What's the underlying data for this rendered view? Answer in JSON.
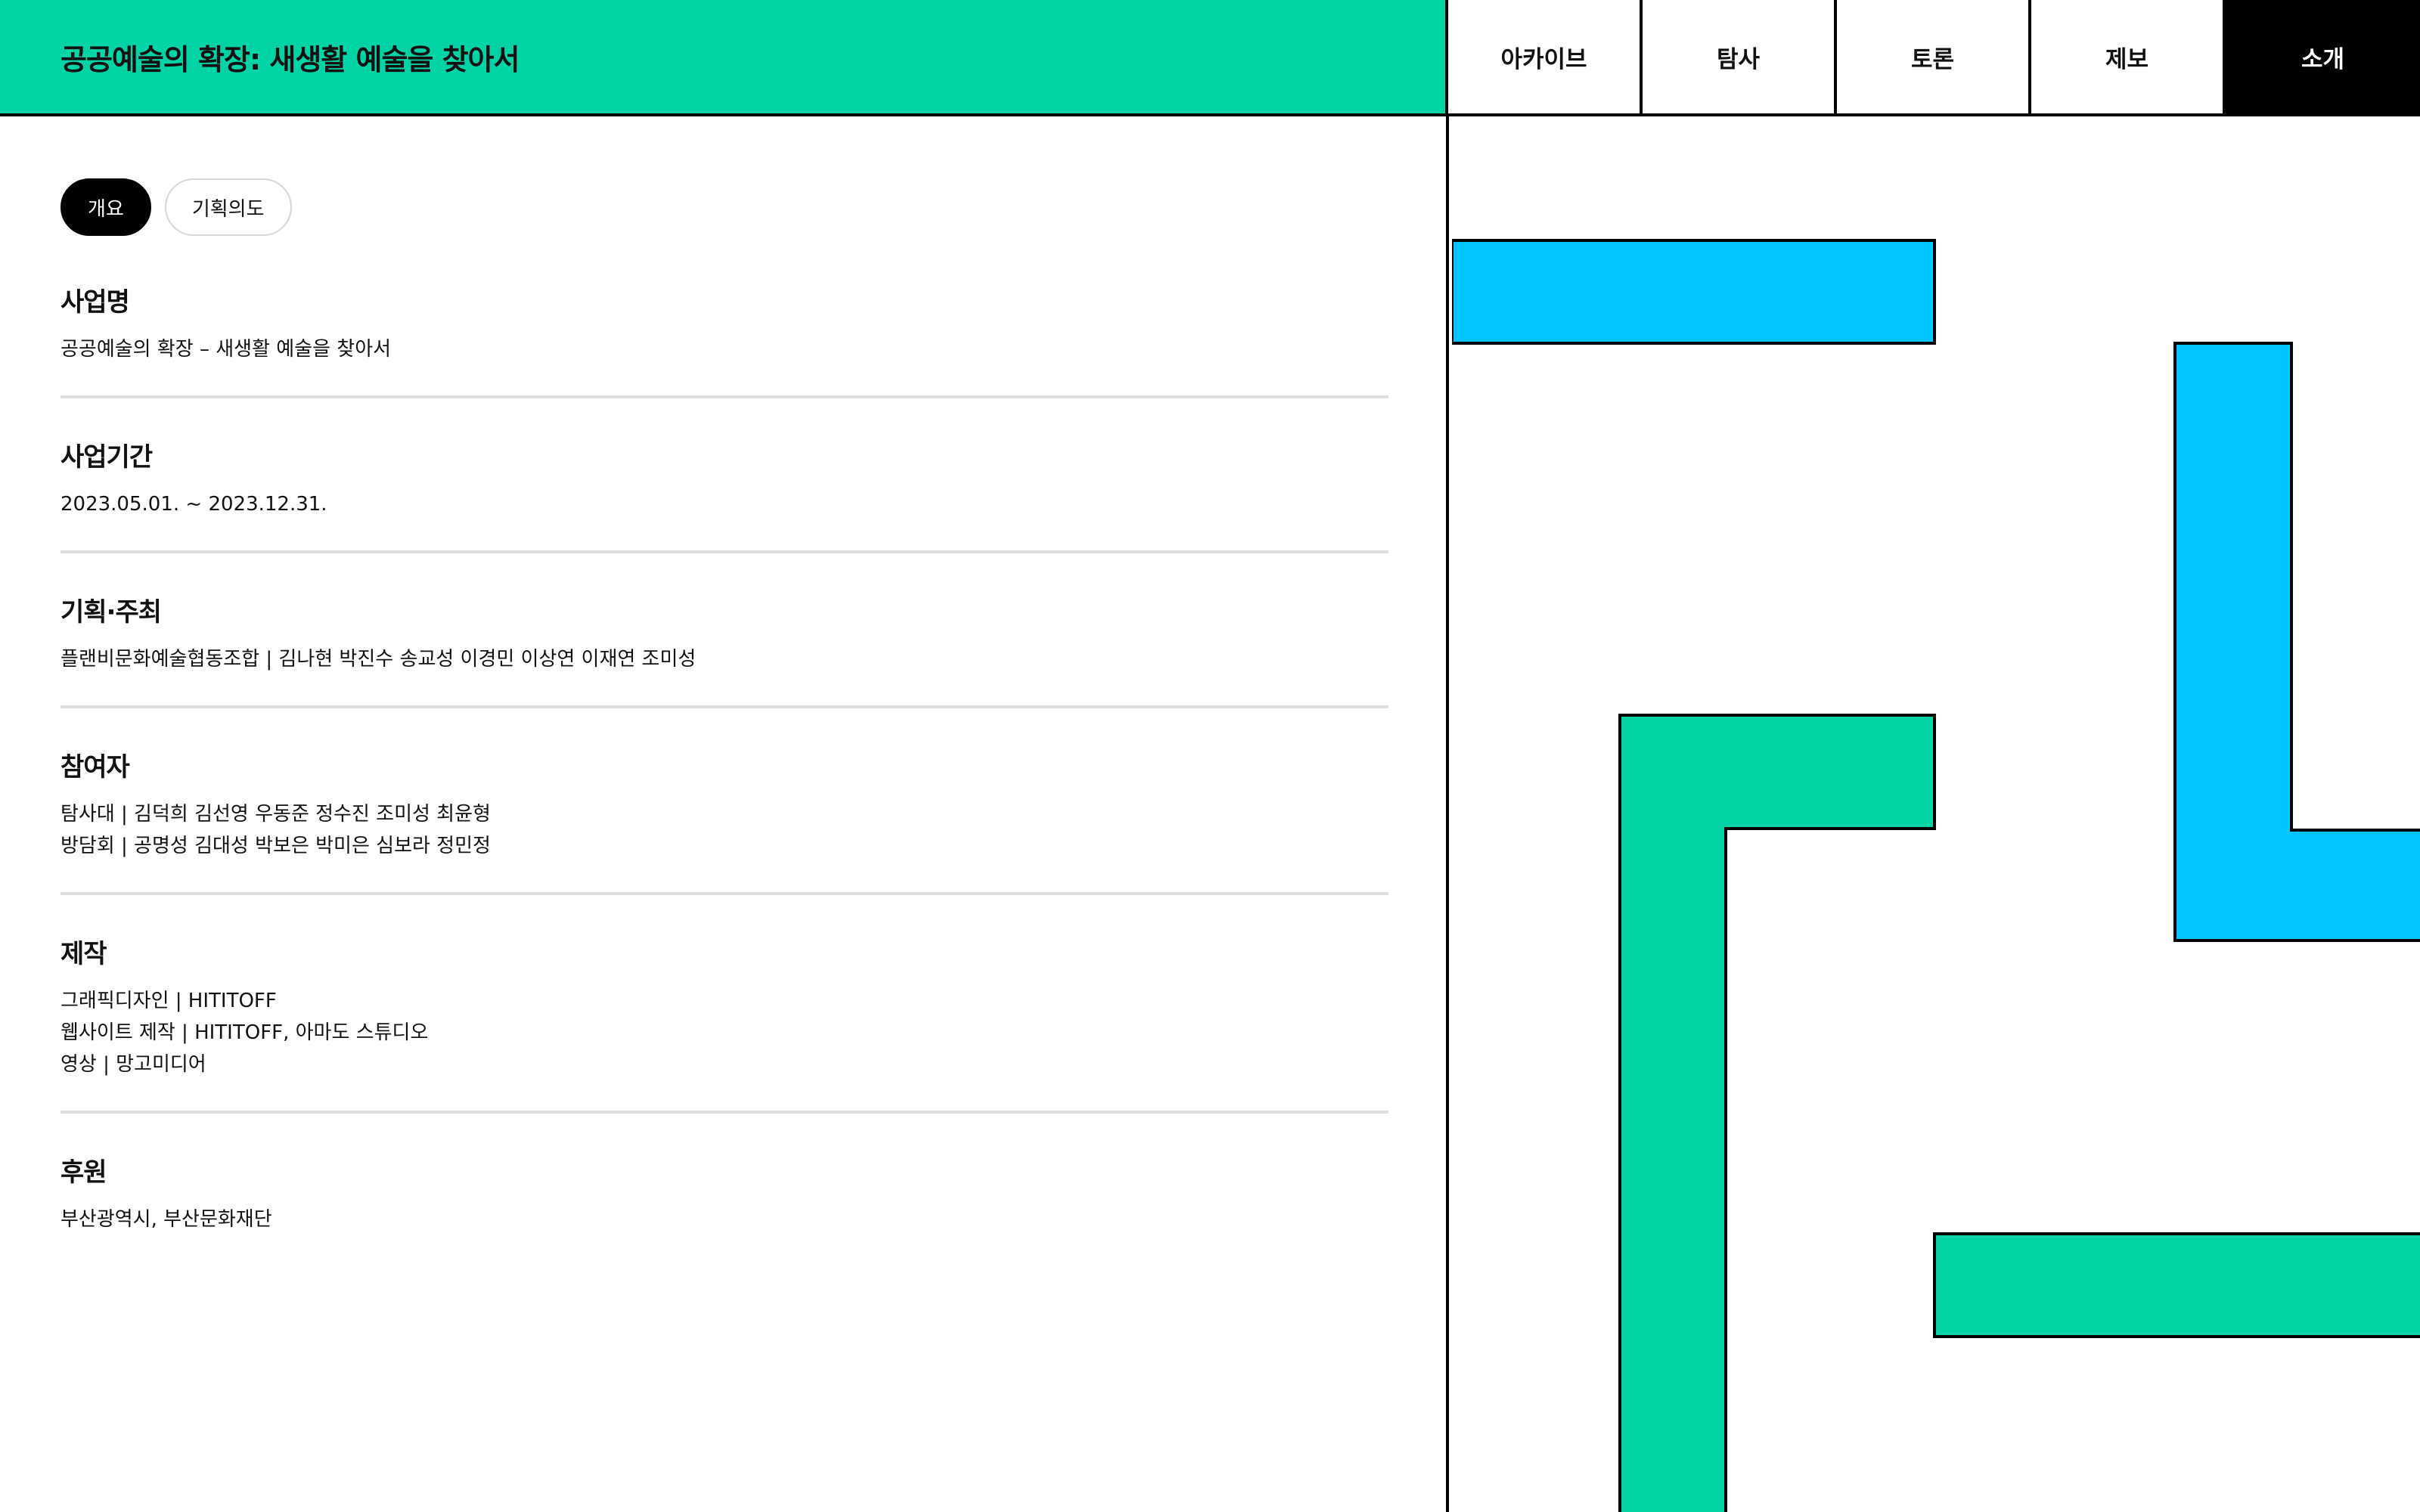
{
  "title": "공공예술의 확장: 새생활 예술을 찾아서",
  "nav": [
    "아카이브",
    "탐사",
    "토론",
    "제보",
    "소개"
  ],
  "active_nav": "소개",
  "tabs": [
    "개요",
    "기획의도"
  ],
  "active_tab": "개요",
  "sections": [
    {
      "heading": "사업명",
      "lines": [
        "공공예술의 확장 – 새생활 예술을 찾아서"
      ]
    },
    {
      "heading": "사업기간",
      "lines": [
        "2023.05.01. ~ 2023.12.31."
      ]
    },
    {
      "heading": "기획·주최",
      "lines": [
        "플랜비문화예술협동조합 | 김나현 박진수 송교성 이경민 이상연 이재연 조미성"
      ]
    },
    {
      "heading": "참여자",
      "lines": [
        "탐사대 | 김덕희 김선영 우동준 정수진 조미성 최윤형",
        "방담회 | 공명성 김대성 박보은 박미은 심보라 정민정"
      ]
    },
    {
      "heading": "제작",
      "lines": [
        "그래픽디자인 | HITITOFF",
        "웹사이트 제작 | HITITOFF, 아마도 스튜디오",
        "영상 | 망고미디어"
      ]
    },
    {
      "heading": "후원",
      "lines": [
        "부산광역시, 부산문화재단"
      ]
    }
  ],
  "colors": {
    "accent_green": "#00d4a4",
    "accent_blue": "#00c4ff",
    "ink": "#000000"
  }
}
